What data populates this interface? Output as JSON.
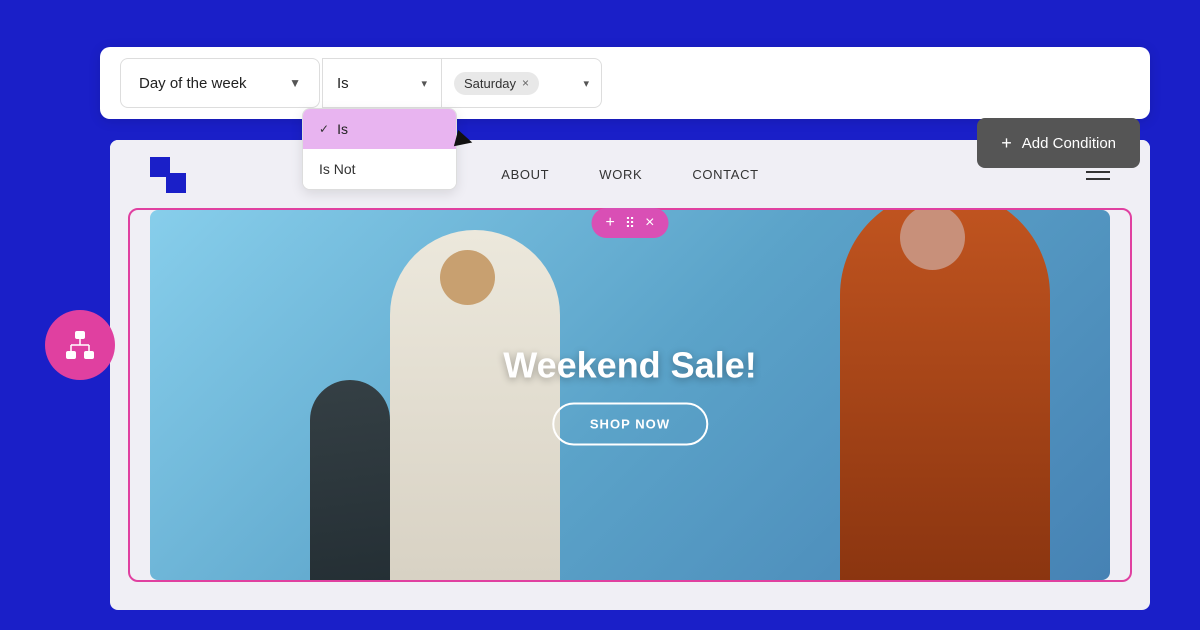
{
  "background": {
    "color": "#1a1fc8"
  },
  "condition_bar": {
    "field_label": "Day of the week",
    "field_arrow": "▼",
    "operator_label": "Is",
    "operator_chevron": "▾",
    "value_chip_label": "Saturday",
    "value_chip_close": "×",
    "value_chevron": "▾"
  },
  "dropdown_menu": {
    "items": [
      {
        "label": "Is",
        "selected": true
      },
      {
        "label": "Is Not",
        "selected": false
      }
    ]
  },
  "add_condition_btn": {
    "icon": "+",
    "label": "Add Condition"
  },
  "navbar": {
    "links": [
      {
        "label": "ABOUT"
      },
      {
        "label": "WORK"
      },
      {
        "label": "CONTACT"
      }
    ]
  },
  "hero": {
    "title": "Weekend Sale!",
    "shop_btn": "SHOP NOW"
  },
  "block_toolbar": {
    "plus": "+",
    "grid": "⠿",
    "close": "×"
  },
  "left_fab": {
    "icon": "⬡"
  }
}
